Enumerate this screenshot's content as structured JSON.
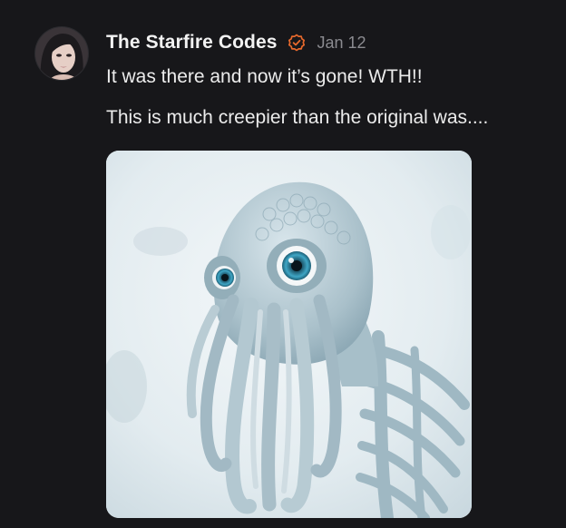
{
  "post": {
    "author": "The Starfire Codes",
    "verified_icon": "verified-check-icon",
    "date": "Jan 12",
    "lines": [
      "It was there and now it’s gone! WTH!!",
      "This is much creepier than the original was...."
    ],
    "avatar_icon": "user-avatar",
    "image_icon": "creature-image"
  },
  "colors": {
    "background": "#17171a",
    "text": "#ececec",
    "muted": "#8b8b90",
    "verified": "#e8692c"
  }
}
